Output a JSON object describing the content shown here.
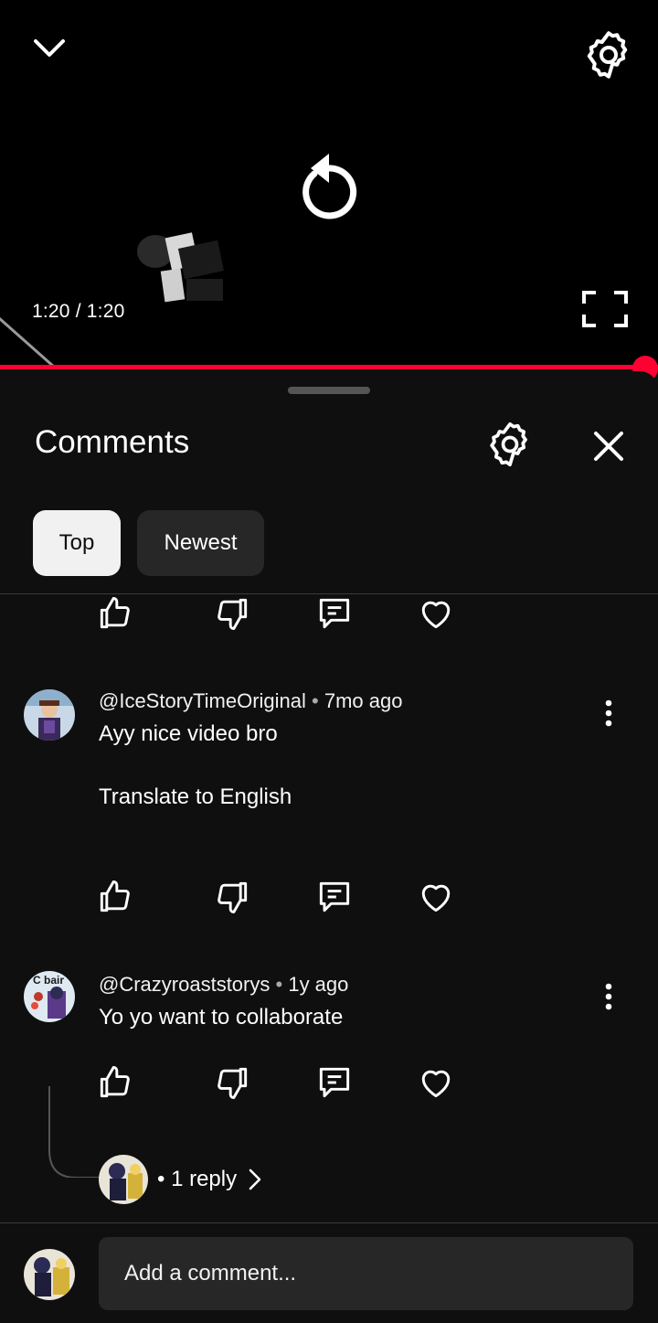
{
  "player": {
    "time": "1:20 / 1:20",
    "progress_fraction": 1.0,
    "accent_color": "#ff0033",
    "icons": {
      "collapse": "chevron-down-icon",
      "settings": "gear-icon",
      "replay": "replay-icon",
      "fullscreen": "fullscreen-icon"
    }
  },
  "comments_panel": {
    "title": "Comments",
    "icons": {
      "settings": "gear-icon",
      "close": "close-icon"
    },
    "tabs": [
      {
        "label": "Top",
        "selected": true
      },
      {
        "label": "Newest",
        "selected": false
      }
    ],
    "action_icons": [
      "thumbs-up-icon",
      "thumbs-down-icon",
      "reply-icon",
      "heart-icon"
    ],
    "comments": [
      {
        "author": "@IceStoryTimeOriginal",
        "separator": "•",
        "age": "7mo ago",
        "text": "Ayy nice video bro",
        "translate_label": "Translate to English"
      },
      {
        "author": "@Crazyroaststorys",
        "separator": "•",
        "age": "1y ago",
        "text": "Yo yo want to collaborate",
        "avatar_text": "C bair",
        "replies_label": "• 1 reply"
      }
    ],
    "composer": {
      "placeholder": "Add a comment..."
    }
  }
}
